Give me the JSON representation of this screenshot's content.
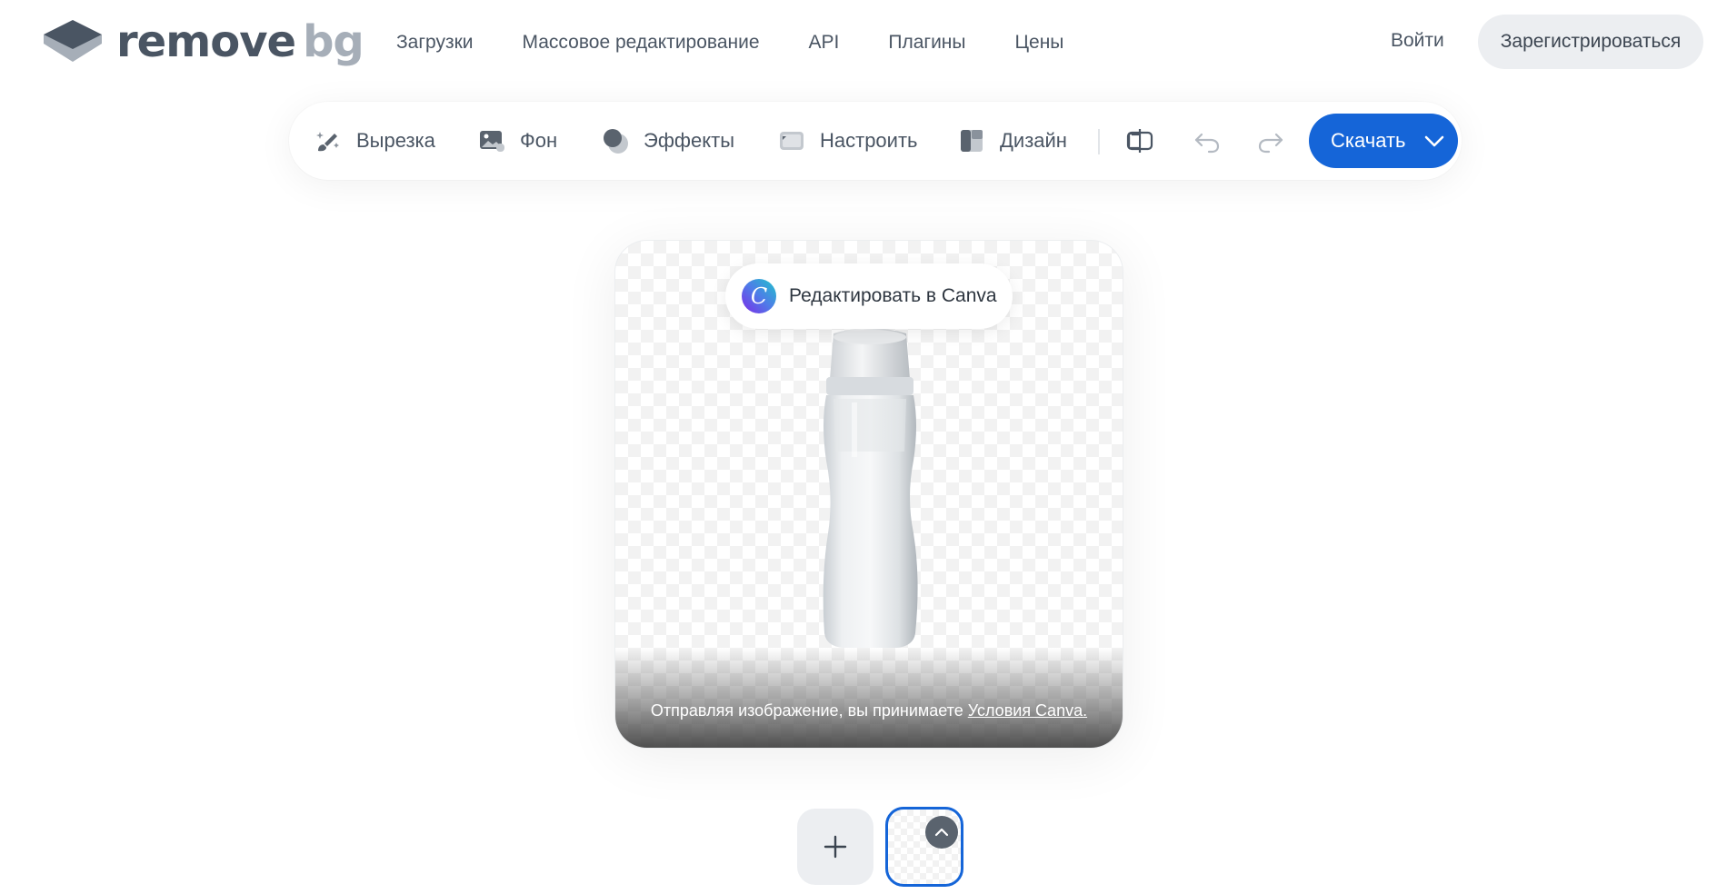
{
  "brand": {
    "word1": "remove",
    "word2": "bg"
  },
  "nav": {
    "items": [
      {
        "label": "Загрузки"
      },
      {
        "label": "Массовое редактирование"
      },
      {
        "label": "API"
      },
      {
        "label": "Плагины"
      },
      {
        "label": "Цены"
      }
    ],
    "login_label": "Войти",
    "signup_label": "Зарегистрироваться"
  },
  "toolbar": {
    "tools": [
      {
        "label": "Вырезка",
        "icon": "brush-sparkle-icon"
      },
      {
        "label": "Фон",
        "icon": "image-icon"
      },
      {
        "label": "Эффекты",
        "icon": "shadow-circles-icon"
      },
      {
        "label": "Настроить",
        "icon": "adjust-card-icon"
      },
      {
        "label": "Дизайн",
        "icon": "layout-icon"
      }
    ],
    "compare_icon": "compare-icon",
    "undo_icon": "undo-icon",
    "redo_icon": "redo-icon",
    "download_label": "Скачать"
  },
  "editor": {
    "canva_label": "Редактировать в Canva",
    "terms_prefix": "Отправляя изображение, вы принимаете",
    "terms_link": "Условия Canva."
  },
  "colors": {
    "accent": "#1565d8",
    "text": "#4a5563",
    "pill_bg": "#eceef1"
  }
}
